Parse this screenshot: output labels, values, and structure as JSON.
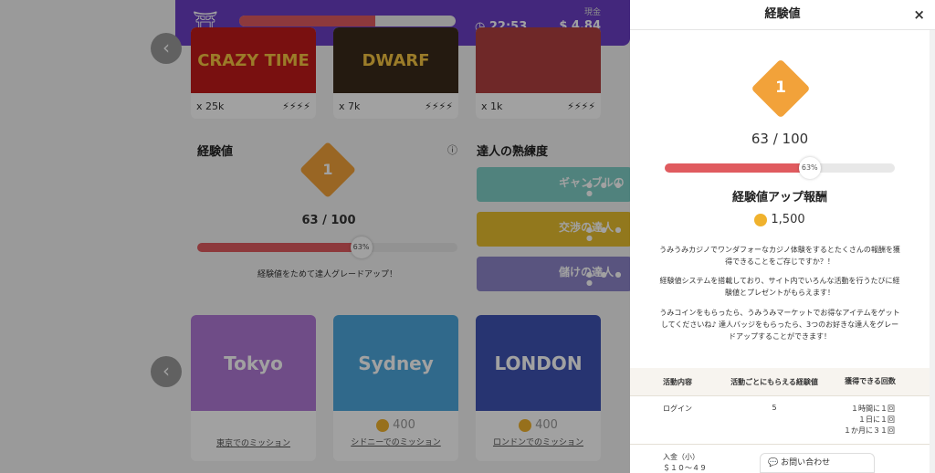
{
  "topbar": {
    "time": "22:53",
    "cash_label": "現金",
    "cash": "$ 4.84",
    "progress": 0.63
  },
  "games": [
    {
      "title": "CRAZY TIME",
      "multiplier": "x 25k",
      "color": "#c01a1a"
    },
    {
      "title": "DWARF",
      "multiplier": "x 7k",
      "color": "#3a2a1a"
    },
    {
      "title": "",
      "multiplier": "x 1k",
      "color": "#b04040"
    }
  ],
  "left": {
    "xp_title": "経験値",
    "level": "1",
    "xp": "63 / 100",
    "xp_pct": "63%",
    "xp_fraction": 0.63,
    "xp_caption": "経験値をためて達人グレードアップ！",
    "mastery_title": "達人の熟練度",
    "badges": [
      {
        "label": "ギャンブルの",
        "color": "#7fcfc6",
        "dots": "● ● ● ●"
      },
      {
        "label": "交渉の達人",
        "color": "#e8bf2e",
        "dots": "● ● ● ●"
      },
      {
        "label": "儲けの達人",
        "color": "#8d86c9",
        "dots": "● ● ● ●"
      }
    ]
  },
  "cities": [
    {
      "name": "Tokyo",
      "color": "#b079d6",
      "coins": "",
      "link": "東京でのミッション"
    },
    {
      "name": "Sydney",
      "color": "#4da6dd",
      "coins": "400",
      "link": "シドニーでのミッション"
    },
    {
      "name": "LONDON",
      "color": "#3e53b3",
      "coins": "400",
      "link": "ロンドンでのミッション"
    }
  ],
  "panel": {
    "title": "経験値",
    "close": "×",
    "level": "1",
    "xp": "63 / 100",
    "xp_pct": "63%",
    "xp_fraction": 0.63,
    "reward_title": "経験値アップ報酬",
    "reward_amount": "1,500",
    "desc1": "うみうみカジノでワンダフォーなカジノ体験をするとたくさんの報酬を獲得できることをご存じですか？！",
    "desc2": "経験値システムを搭載しており、サイト内でいろんな活動を行うたびに経験値とプレゼントがもらえます！",
    "desc3": "うみコインをもらったら、うみうみマーケットでお得なアイテムをゲットしてくださいね♪ 達人バッジをもらったら、3つのお好きな達人をグレードアップすることができます！",
    "table": {
      "headers": [
        "活動内容",
        "活動ごとにもらえる経験値",
        "獲得できる回数"
      ],
      "rows": [
        {
          "activity": "ログイン",
          "xp": "5",
          "count": [
            "１時間に１回",
            "１日に１回",
            "１か月に３１回"
          ]
        },
        {
          "activity": "入金（小）",
          "activity2": "＄１０～４９",
          "xp": "",
          "count": []
        }
      ]
    },
    "chat": "お問い合わせ"
  }
}
